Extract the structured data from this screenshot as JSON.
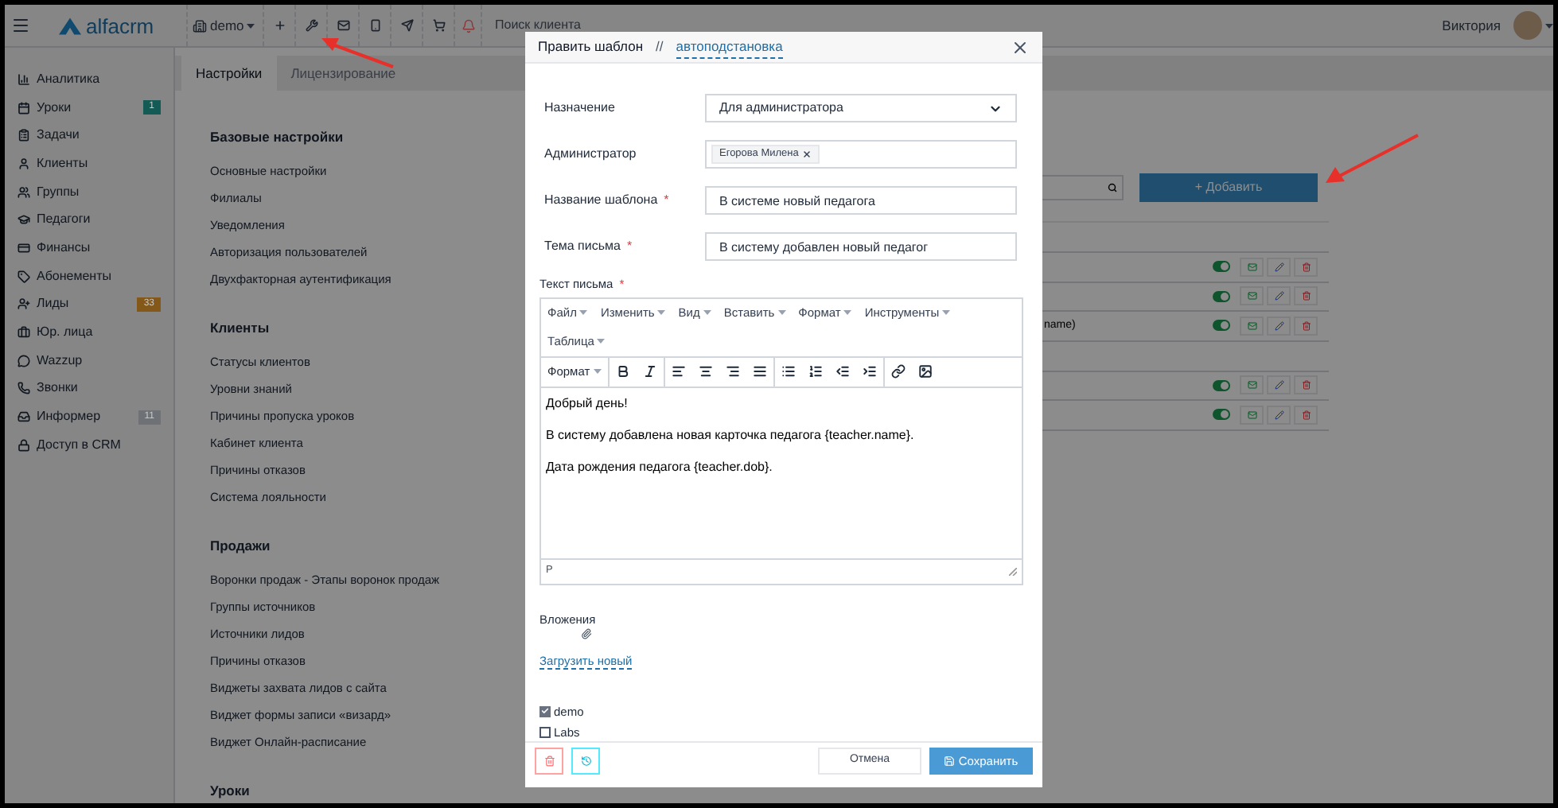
{
  "topbar": {
    "logo": "alfacrm",
    "branch": "demo",
    "search_placeholder": "Поиск клиента",
    "user": "Виктория"
  },
  "sidebar": {
    "items": [
      {
        "label": "Аналитика"
      },
      {
        "label": "Уроки",
        "badge": "1",
        "color": "#155b55"
      },
      {
        "label": "Задачи"
      },
      {
        "label": "Клиенты"
      },
      {
        "label": "Группы"
      },
      {
        "label": "Педагоги"
      },
      {
        "label": "Финансы"
      },
      {
        "label": "Абонементы"
      },
      {
        "label": "Лиды",
        "badge": "33",
        "color": "#845818"
      },
      {
        "label": "Юр. лица"
      },
      {
        "label": "Wazzup"
      },
      {
        "label": "Звонки"
      },
      {
        "label": "Информер",
        "badge": "11",
        "color": "#6e7277"
      },
      {
        "label": "Доступ в CRM"
      }
    ]
  },
  "tabs": [
    {
      "label": "Настройки",
      "selected": true
    },
    {
      "label": "Лицензирование",
      "selected": false
    }
  ],
  "settings_sections": [
    {
      "title": "Базовые настройки",
      "items": [
        "Основные настройки",
        "Филиалы",
        "Уведомления",
        "Авторизация пользователей",
        "Двухфакторная аутентификация"
      ]
    },
    {
      "title": "Клиенты",
      "items": [
        "Статусы клиентов",
        "Уровни знаний",
        "Причины пропуска уроков",
        "Кабинет клиента",
        "Причины отказов",
        "Система лояльности"
      ]
    },
    {
      "title": "Продажи",
      "items": [
        "Воронки продаж - Этапы воронок продаж",
        "Группы источников",
        "Источники лидов",
        "Причины отказов",
        "Виджеты захвата лидов с сайта",
        "Виджет формы записи «визард»",
        "Виджет Онлайн-расписание"
      ]
    },
    {
      "title": "Уроки"
    }
  ],
  "templates": {
    "add_button": "+ Добавить",
    "groups": [
      {
        "rows": [
          {
            "on": true
          },
          {
            "on": true
          },
          {
            "on": true,
            "text": "name)"
          }
        ]
      },
      {
        "rows": [
          {
            "on": true
          },
          {
            "on": true
          }
        ]
      }
    ]
  },
  "modal": {
    "title": "Править шаблон",
    "separator": "//",
    "link": "автоподстановка",
    "required_mark": "*",
    "fields": [
      {
        "kind": "select",
        "label": "Назначение",
        "value": "Для администратора"
      },
      {
        "kind": "tags",
        "label": "Администратор",
        "tags": [
          "Егорова Милена"
        ]
      },
      {
        "kind": "text",
        "label": "Название шаблона",
        "value": "В системе новый педагога",
        "required": true
      },
      {
        "kind": "text",
        "label": "Тема письма",
        "value": "В систему добавлен новый педагог",
        "required": true
      }
    ],
    "editor": {
      "label": "Текст письма",
      "required": true,
      "menus": [
        "Файл",
        "Изменить",
        "Вид",
        "Вставить",
        "Формат",
        "Инструменты",
        "Таблица"
      ],
      "format_dropdown": "Формат",
      "paragraphs": [
        "Добрый день!",
        "В систему добавлена новая карточка педагога {teacher.name}.",
        "Дата рождения педагога {teacher.dob}."
      ],
      "status": "P"
    },
    "attachments": {
      "label": "Вложения",
      "upload_link": "Загрузить новый"
    },
    "branches": [
      {
        "label": "demo",
        "checked": true
      },
      {
        "label": "Labs",
        "checked": false
      }
    ],
    "cancel_button": "Отмена",
    "save_button": "Сохранить"
  }
}
